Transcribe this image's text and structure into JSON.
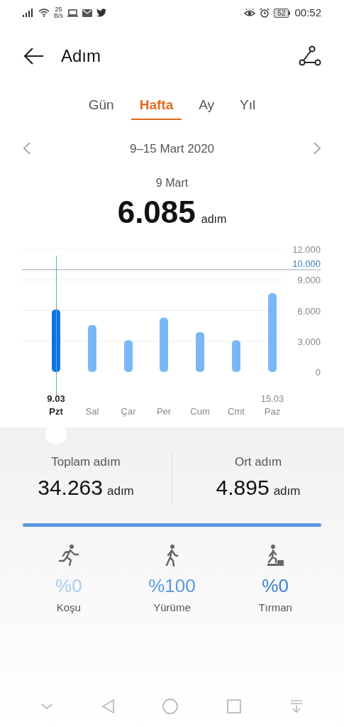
{
  "status_bar": {
    "speed_value": "25",
    "speed_unit": "B/s",
    "battery": "52",
    "time": "00:52"
  },
  "header": {
    "title": "Adım"
  },
  "tabs": [
    {
      "label": "Gün",
      "selected": false
    },
    {
      "label": "Hafta",
      "selected": true
    },
    {
      "label": "Ay",
      "selected": false
    },
    {
      "label": "Yıl",
      "selected": false
    }
  ],
  "date_range": "9–15 Mart 2020",
  "selected_day": {
    "date": "9 Mart",
    "value": "6.085",
    "unit": "adım"
  },
  "chart": {
    "range_start": "9.03",
    "range_end": "15.03",
    "bars": [
      {
        "selected": true
      },
      {
        "selected": false
      },
      {
        "selected": false
      },
      {
        "selected": false
      },
      {
        "selected": false
      },
      {
        "selected": false
      },
      {
        "selected": false
      }
    ],
    "chart_data": {
      "type": "bar",
      "categories": [
        "Pzt",
        "Sal",
        "Çar",
        "Per",
        "Cum",
        "Cmt",
        "Paz"
      ],
      "series": [
        {
          "color": "#0a74ea",
          "values": [
            6.1,
            null,
            null,
            null,
            null,
            null,
            null
          ]
        },
        {
          "color": "#7ab8f5",
          "values": [
            null,
            4.6,
            3.1,
            5.3,
            3.9,
            3.1,
            7.7
          ]
        }
      ],
      "ylim": [
        0,
        12
      ],
      "yticks": [
        {
          "value": 0,
          "label": "0"
        },
        {
          "value": 3,
          "label": "3.000"
        },
        {
          "value": 6,
          "label": "6.000"
        },
        {
          "value": 9,
          "label": "9.000"
        },
        {
          "value": 12,
          "label": "12.000"
        }
      ],
      "grid": true,
      "ref_lines": [
        {
          "value": 10,
          "axis": "y",
          "label": "10.000",
          "color": "#99aabb"
        }
      ]
    }
  },
  "stats": [
    {
      "label": "Toplam adım",
      "value": "34.263",
      "unit": "adım"
    },
    {
      "label": "Ort adım",
      "value": "4.895",
      "unit": "adım"
    }
  ],
  "activities": [
    {
      "kind": "run",
      "percent": "%0",
      "label": "Koşu",
      "color": "#a9cdf2"
    },
    {
      "kind": "walk",
      "percent": "%100",
      "label": "Yürüme",
      "color": "#5b9be0"
    },
    {
      "kind": "climb",
      "percent": "%0",
      "label": "Tırman",
      "color": "#3a7fd0"
    }
  ]
}
